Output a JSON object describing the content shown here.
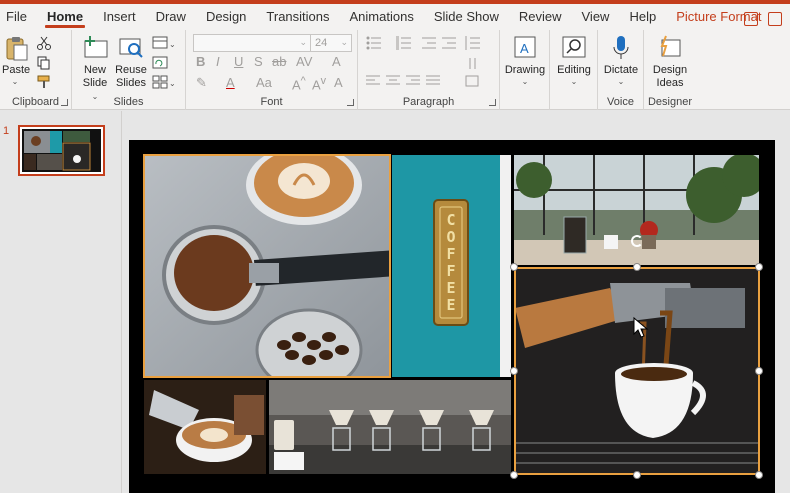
{
  "tabs": [
    "File",
    "Home",
    "Insert",
    "Draw",
    "Design",
    "Transitions",
    "Animations",
    "Slide Show",
    "Review",
    "View",
    "Help",
    "Picture Format"
  ],
  "active_tab": "Home",
  "ribbon": {
    "clipboard": {
      "label": "Clipboard",
      "paste": "Paste"
    },
    "slides": {
      "label": "Slides",
      "new_slide_1": "New",
      "new_slide_2": "Slide",
      "reuse_1": "Reuse",
      "reuse_2": "Slides"
    },
    "font": {
      "label": "Font",
      "size_value": "24"
    },
    "paragraph": {
      "label": "Paragraph"
    },
    "drawing": {
      "label": "Drawing"
    },
    "editing": {
      "label": "Editing"
    },
    "voice": {
      "label": "Voice",
      "dictate": "Dictate"
    },
    "designer": {
      "label": "Designer",
      "design_1": "Design",
      "design_2": "Ideas"
    }
  },
  "slides_pane": {
    "slide_number": "1"
  },
  "slide": {
    "sign_text": "COFFEE"
  },
  "colors": {
    "accent": "#c43e1c",
    "selection": "#e9a040",
    "ribbon_bg": "#f3f2f1"
  }
}
